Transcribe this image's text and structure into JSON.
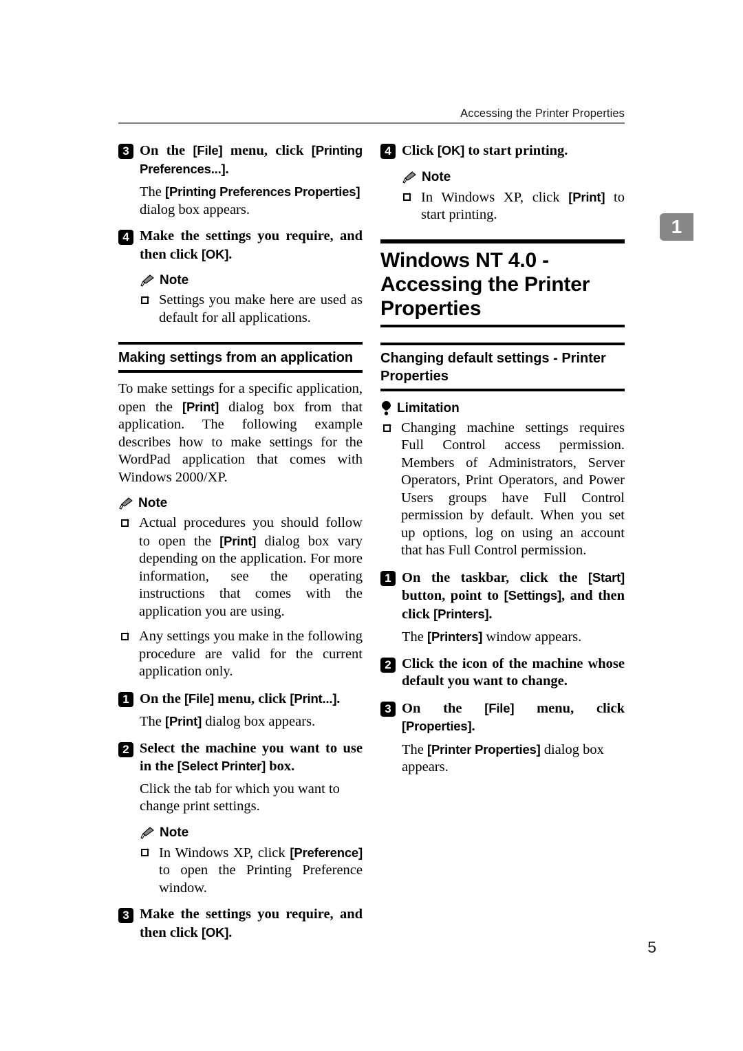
{
  "header": {
    "running_title": "Accessing the Printer Properties"
  },
  "chapter_tab": {
    "number": "1"
  },
  "folio": {
    "page_number": "5"
  },
  "labels": {
    "note": "Note",
    "limitation": "Limitation"
  },
  "left_column": {
    "step3": {
      "number": "3",
      "text_a": "On the ",
      "ui_file": "[File]",
      "text_b": " menu, click ",
      "ui_printing_prefs": "[Printing Preferences...]",
      "text_c": "."
    },
    "step3_follow": {
      "text_a": "The ",
      "ui_dialog": "[Printing Preferences Properties]",
      "text_b": " dialog box appears."
    },
    "step4": {
      "number": "4",
      "text_a": "Make the settings you require, and then click ",
      "ui_ok": "[OK]",
      "text_b": "."
    },
    "step4_note_bullet": "Settings you make here are used as default for all applications.",
    "subheading": "Making settings from an application",
    "intro_par": {
      "text_a": "To make settings for a specific application, open the ",
      "ui_print": "[Print]",
      "text_b": " dialog box from that application. The following example describes how to make settings for the WordPad application that comes with Windows 2000/XP."
    },
    "note_bullets": [
      {
        "text_a": "Actual procedures you should follow to open the ",
        "ui": "[Print]",
        "text_b": " dialog box vary depending on the application. For more information, see the operating instructions that comes with the application you are using."
      },
      {
        "text_a": "Any settings you make in the following procedure are valid for the current application only.",
        "ui": "",
        "text_b": ""
      }
    ],
    "step1": {
      "number": "1",
      "text_a": "On the ",
      "ui_file": "[File]",
      "text_b": " menu, click ",
      "ui_print": "[Print...]",
      "text_c": "."
    },
    "step1_follow": {
      "text_a": "The ",
      "ui_print": "[Print]",
      "text_b": " dialog box appears."
    },
    "step2": {
      "number": "2",
      "text_a": "Select the machine you want to use in the ",
      "ui_select_printer": "[Select Printer]",
      "text_b": " box."
    },
    "step2_follow": "Click the tab for which you want to change print settings.",
    "step2_note_bullet": {
      "text_a": "In Windows XP, click ",
      "ui": "[Preference]",
      "text_b": " to open the Printing Preference window."
    },
    "step3b": {
      "number": "3",
      "text_a": "Make the settings you require, and then click ",
      "ui_ok": "[OK]",
      "text_b": "."
    }
  },
  "right_column": {
    "step4": {
      "number": "4",
      "text_a": "Click ",
      "ui_ok": "[OK]",
      "text_b": " to start printing."
    },
    "step4_note_bullet": {
      "text_a": "In Windows XP, click ",
      "ui": "[Print]",
      "text_b": " to start printing."
    },
    "heading": "Windows NT 4.0 - Accessing the Printer Properties",
    "subheading": "Changing default settings - Printer Properties",
    "limitation_bullet": "Changing machine settings requires Full Control access permission. Members of Administrators, Server Operators, Print Operators, and Power Users groups have Full Control permission by default. When you set up options, log on using an account that has Full Control permission.",
    "step1": {
      "number": "1",
      "text_a": "On the taskbar, click the ",
      "ui_start": "[Start]",
      "text_b": " button, point to ",
      "ui_settings": "[Settings]",
      "text_c": ", and then click ",
      "ui_printers": "[Printers]",
      "text_d": "."
    },
    "step1_follow": {
      "text_a": "The ",
      "ui_printers": "[Printers]",
      "text_b": " window appears."
    },
    "step2": {
      "number": "2",
      "text_a": "Click the icon of the machine whose default you want to change."
    },
    "step3": {
      "number": "3",
      "text_a": "On the ",
      "ui_file": "[File]",
      "text_b": " menu, click ",
      "ui_properties": "[Properties]",
      "text_c": "."
    },
    "step3_follow": {
      "text_a": "The ",
      "ui_printer_props": "[Printer Properties]",
      "text_b": " dialog box appears."
    }
  }
}
